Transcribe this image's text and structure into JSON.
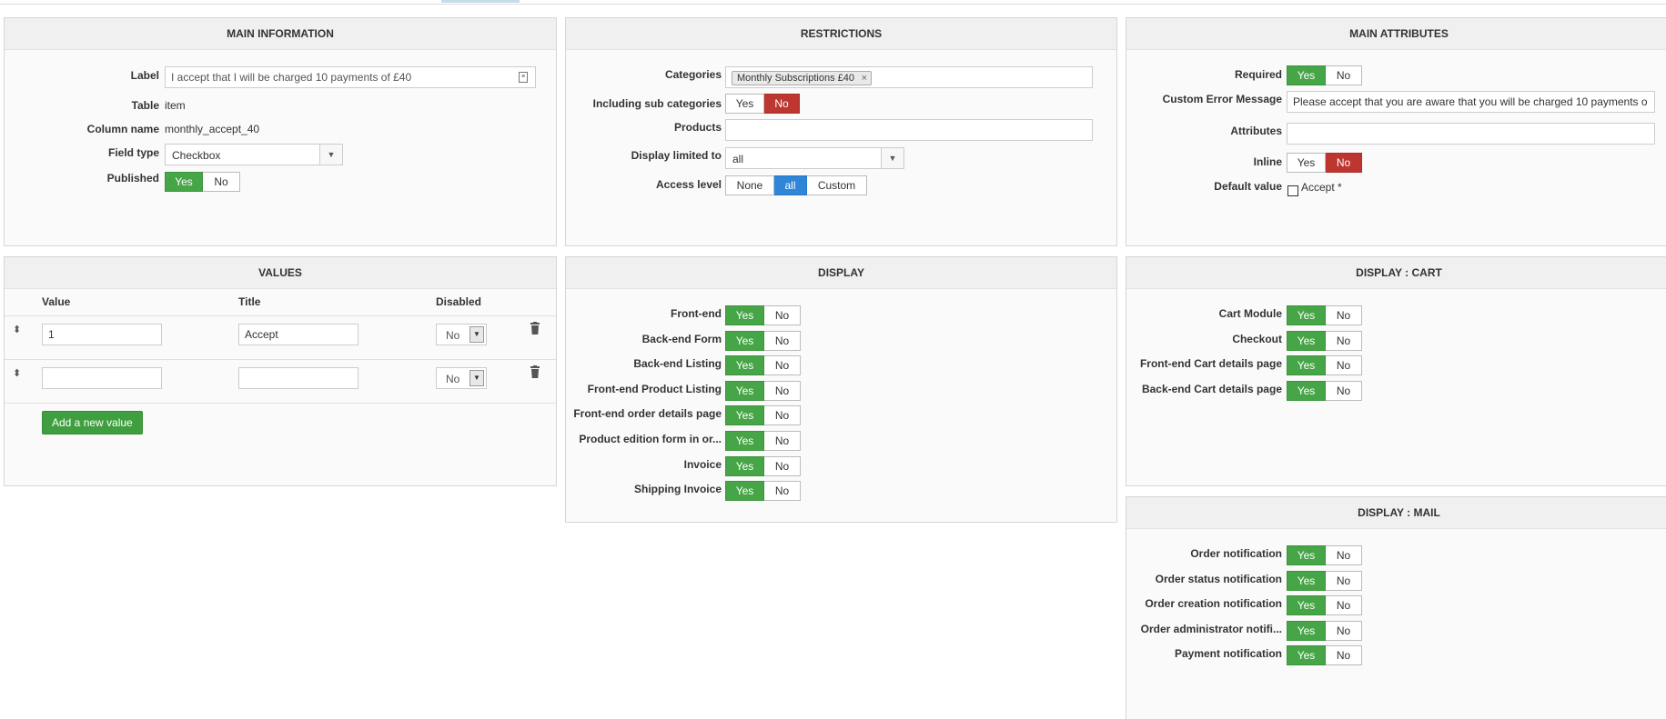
{
  "main_information": {
    "title": "MAIN INFORMATION",
    "label_label": "Label",
    "label_value": "I accept that I will be charged 10 payments of £40",
    "table_label": "Table",
    "table_value": "item",
    "column_label": "Column name",
    "column_value": "monthly_accept_40",
    "field_type_label": "Field type",
    "field_type_value": "Checkbox",
    "published_label": "Published",
    "yes": "Yes",
    "no": "No"
  },
  "restrictions": {
    "title": "RESTRICTIONS",
    "categories_label": "Categories",
    "categories_tag": "Monthly Subscriptions £40",
    "sub_label": "Including sub categories",
    "products_label": "Products",
    "display_limited_label": "Display limited to",
    "display_limited_value": "all",
    "access_label": "Access level",
    "access_none": "None",
    "access_all": "all",
    "access_custom": "Custom",
    "yes": "Yes",
    "no": "No"
  },
  "main_attributes": {
    "title": "MAIN ATTRIBUTES",
    "required_label": "Required",
    "error_label": "Custom Error Message",
    "error_value": "Please accept that you are aware that you will be charged 10 payments o",
    "attributes_label": "Attributes",
    "inline_label": "Inline",
    "default_label": "Default value",
    "default_option": "Accept *",
    "yes": "Yes",
    "no": "No"
  },
  "values": {
    "title": "VALUES",
    "col_value": "Value",
    "col_title": "Title",
    "col_disabled": "Disabled",
    "rows": [
      {
        "value": "1",
        "title": "Accept",
        "disabled": "No"
      },
      {
        "value": "",
        "title": "",
        "disabled": "No"
      }
    ],
    "add_button": "Add a new value"
  },
  "display": {
    "title": "DISPLAY",
    "items": [
      "Front-end",
      "Back-end Form",
      "Back-end Listing",
      "Front-end Product Listing",
      "Front-end order details page",
      "Product edition form in or...",
      "Invoice",
      "Shipping Invoice"
    ],
    "yes": "Yes",
    "no": "No"
  },
  "display_cart": {
    "title": "DISPLAY : CART",
    "items": [
      "Cart Module",
      "Checkout",
      "Front-end Cart details page",
      "Back-end Cart details page"
    ],
    "yes": "Yes",
    "no": "No"
  },
  "display_mail": {
    "title": "DISPLAY : MAIL",
    "items": [
      "Order notification",
      "Order status notification",
      "Order creation notification",
      "Order administrator notifi...",
      "Payment notification"
    ],
    "yes": "Yes",
    "no": "No"
  },
  "colors": {
    "yes_active": "#46a546",
    "no_active": "#bd362f",
    "all_active": "#2f86d8"
  }
}
